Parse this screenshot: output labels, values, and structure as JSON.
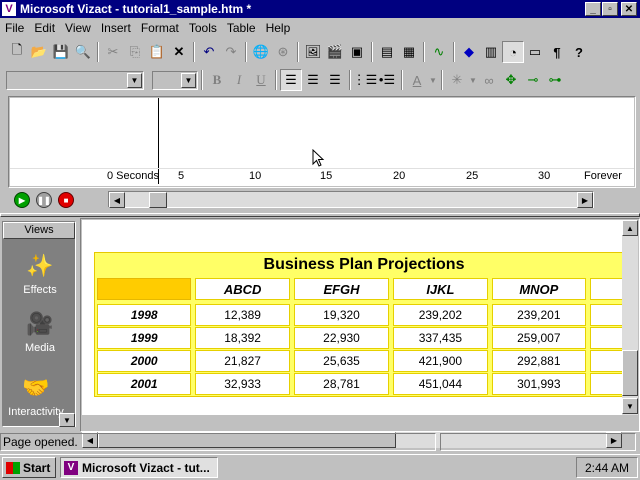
{
  "window": {
    "title": "Microsoft Vizact - tutorial1_sample.htm *",
    "app_icon": "V"
  },
  "menu": [
    "File",
    "Edit",
    "View",
    "Insert",
    "Format",
    "Tools",
    "Table",
    "Help"
  ],
  "timeline": {
    "ticks": [
      "0 Seconds",
      "5",
      "10",
      "15",
      "20",
      "25",
      "30",
      "Forever"
    ]
  },
  "views": {
    "header": "Views",
    "items": [
      "Effects",
      "Media",
      "Interactivity"
    ]
  },
  "document": {
    "table_title": "Business Plan Projections",
    "columns": [
      "ABCD",
      "EFGH",
      "IJKL",
      "MNOP"
    ],
    "rows": [
      {
        "year": "1998",
        "values": [
          "12,389",
          "19,320",
          "239,202",
          "239,201"
        ]
      },
      {
        "year": "1999",
        "values": [
          "18,392",
          "22,930",
          "337,435",
          "259,007"
        ]
      },
      {
        "year": "2000",
        "values": [
          "21,827",
          "25,635",
          "421,900",
          "292,881"
        ]
      },
      {
        "year": "2001",
        "values": [
          "32,933",
          "28,781",
          "451,044",
          "301,993"
        ]
      }
    ]
  },
  "status": {
    "text": "Page opened."
  },
  "taskbar": {
    "start": "Start",
    "task": "Microsoft Vizact - tut...",
    "clock": "2:44 AM"
  },
  "colors": {
    "titlebar": "#000080",
    "table_bg": "#ffff66",
    "header_accent": "#ffcc00"
  }
}
